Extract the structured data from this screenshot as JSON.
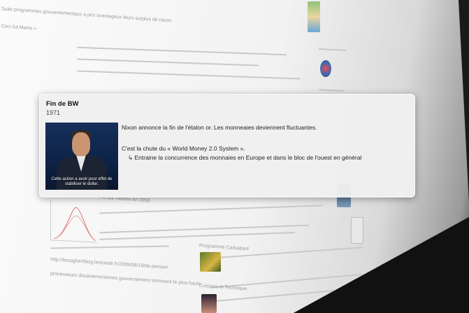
{
  "card": {
    "title": "Fin de BW",
    "year": "1971",
    "video_caption": "Cette action a avoir pour effet de stabiliser le dollar.",
    "line1": "Nixon annonce la fin de l'étalon or. Les monneaies deviennent fluctuantes.",
    "line2": "C'est la chute du « World Money 2.0 System ».",
    "line3": "↳ Entraine la concurrence des monnaies en Europe et dans le bloc de l'ouest en général"
  },
  "background": {
    "snippet_top": "Suite programmes gouvernementaux a prix avantageux leurs surplus de razon",
    "snippet_top2": "Ceci fut Manis »",
    "snippet_mid": "Pic sur l'avenir en 1958",
    "snippet_url": "http://lesaigher/blog.lemonde.fr/2009/06/19/de-penser/",
    "snippet_low": "processeurs douanieres/armes gouvernement terminent le plus hauts",
    "snippet_side1": "Programme Carbabaril",
    "snippet_side2": "Cuisines et Technique"
  },
  "colors": {
    "card_bg": "#f0f0f0",
    "page_bg": "#f4f4f4",
    "floor": "#111111"
  }
}
